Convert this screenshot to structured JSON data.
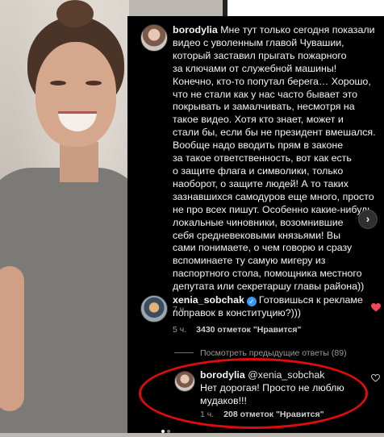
{
  "post_comment": {
    "username": "borodylia",
    "text": "Мне тут только сегодня показали видео с уволенным главой Чувашии, который заставил прыгать пожарного за ключами от служебной машины! Конечно, кто-то попутал берега… Хорошо, что не стали как у нас часто бывает это покрывать и замалчивать, несмотря на такое видео. Хотя кто знает, может и стали бы, если бы не президент вмешался. Вообще надо вводить прям в законе за такое ответственность, вот как есть о защите флага и символики, только наоборот, о защите людей! А то таких зазнавшихся самодуров еще много, просто не про всех пишут. Особенно какие-нибудь локальные чиновники, возомнившие себя средневековыми князьями! Вы сами понимаете, о чем говорю и сразу вспоминаете ту самую мигеру из паспортного стола, помощника местного депутата или секретаршу главы района))",
    "lines": [
      "Мне тут только сегодня показали",
      "видео с уволенным главой Чувашии,",
      "который заставил прыгать пожарного",
      "за ключами от служебной машины!",
      "Конечно, кто-то попутал берега… Хорошо,",
      "что не стали как у нас часто бывает это",
      "покрывать и замалчивать, несмотря на",
      "такое видео. Хотя кто знает, может и",
      "стали бы, если бы не президент вмешался.",
      "Вообще надо вводить прям в законе",
      "за такое ответственность, вот как есть",
      "о защите флага и символики, только",
      "наоборот, о защите людей! А то таких",
      "зазнавшихся самодуров еще много, просто",
      "не про всех пишут. Особенно какие-нибудь",
      "локальные чиновники, возомнившие",
      "себя средневековыми князьями! Вы",
      "сами понимаете, о чем говорю и сразу",
      "вспоминаете ту самую мигеру из",
      "паспортного стола, помощника местного",
      "депутата или секретаршу главы района))"
    ],
    "time": "7 ч."
  },
  "comment1": {
    "username": "xenia_sobchak",
    "verified_icon": "✓",
    "line1": "Готовишься к рекламе",
    "line2": "поправок в конституцию?)))",
    "time": "5 ч.",
    "likes": "3430 отметок \"Нравится\"",
    "heart_color": "#ed4956"
  },
  "view_previous": "Посмотреть предыдущие ответы (89)",
  "reply": {
    "username": "borodylia",
    "mention": "@xenia_sobchak",
    "line1": "Нет дорогая! Просто не люблю",
    "line2": "мудаков!!!",
    "time": "1 ч.",
    "likes": "208 отметок \"Нравится\""
  },
  "next_arrow": "›",
  "icons": [
    "heart-icon",
    "verified-icon",
    "chevron-right-icon"
  ]
}
